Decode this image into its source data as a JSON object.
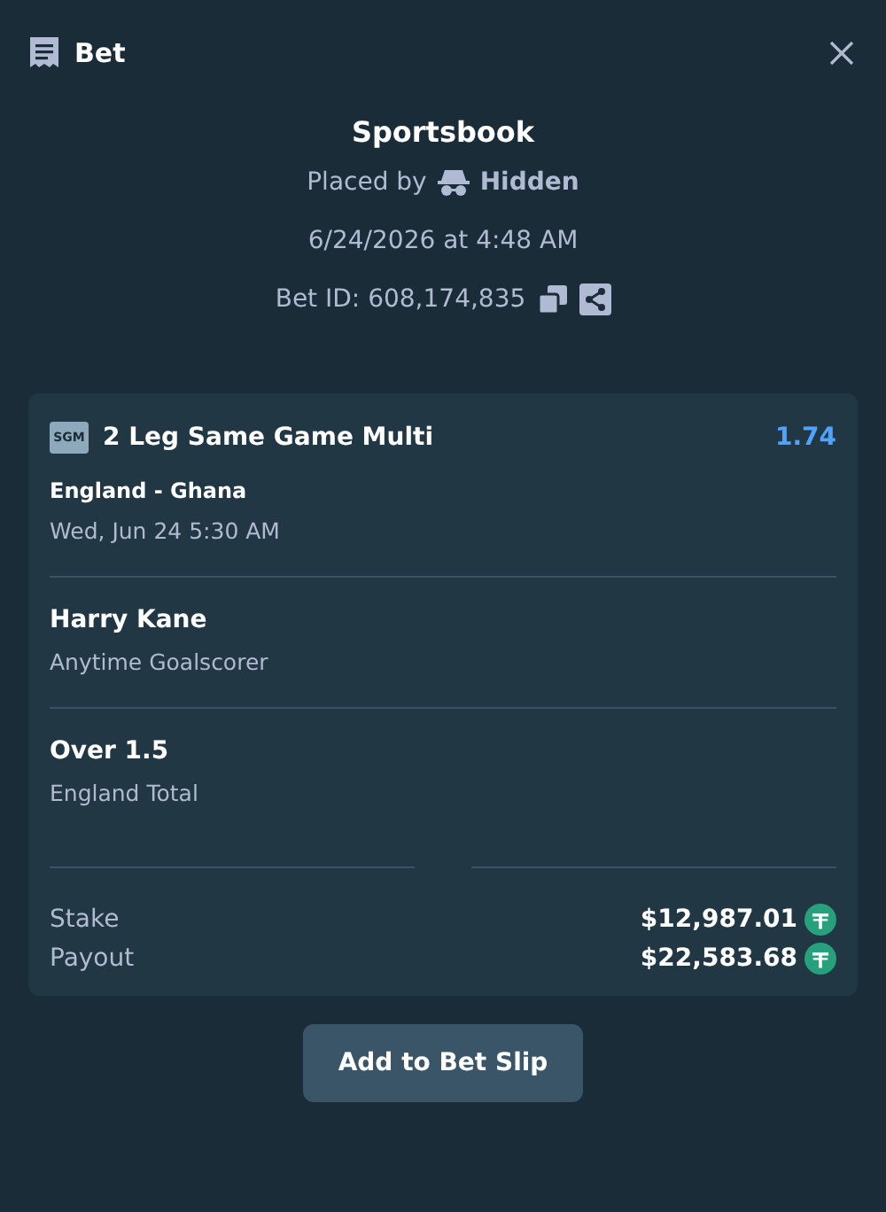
{
  "header": {
    "title": "Bet"
  },
  "summary": {
    "title": "Sportsbook",
    "placed_by_label": "Placed by",
    "placed_by_user": "Hidden",
    "date": "6/24/2026 at 4:48 AM",
    "bet_id": "Bet ID: 608,174,835"
  },
  "bet": {
    "badge": "SGM",
    "title": "2 Leg Same Game Multi",
    "odds": "1.74",
    "match": "England - Ghana",
    "match_time": "Wed, Jun 24 5:30 AM",
    "legs": [
      {
        "selection": "Harry Kane",
        "market": "Anytime Goalscorer"
      },
      {
        "selection": "Over 1.5",
        "market": "England Total"
      }
    ],
    "totals": [
      {
        "label": "Stake",
        "value": "$12,987.01"
      },
      {
        "label": "Payout",
        "value": "$22,583.68"
      }
    ]
  },
  "button": "Add to Bet Slip"
}
